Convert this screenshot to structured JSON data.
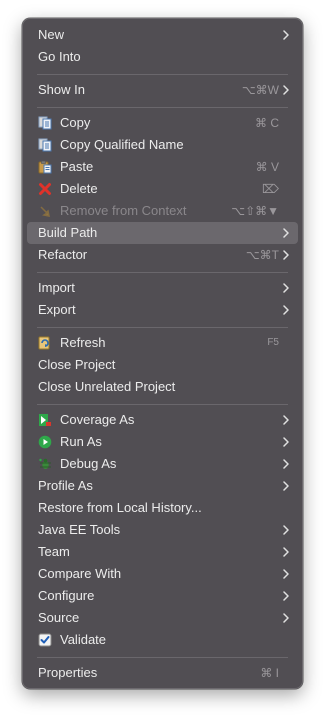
{
  "menu": {
    "items": {
      "new": {
        "label": "New"
      },
      "go_into": {
        "label": "Go Into"
      },
      "show_in": {
        "label": "Show In",
        "shortcut": "⌥⌘W"
      },
      "copy": {
        "label": "Copy",
        "shortcut": "⌘ C",
        "icon": "copy-icon"
      },
      "copy_qualified": {
        "label": "Copy Qualified Name",
        "icon": "copy-qualified-icon"
      },
      "paste": {
        "label": "Paste",
        "shortcut": "⌘ V",
        "icon": "paste-icon"
      },
      "delete": {
        "label": "Delete",
        "shortcut": "⌦",
        "icon": "delete-icon",
        "icon_color": "#e0322a"
      },
      "remove_context": {
        "label": "Remove from Context",
        "shortcut": "⌥⇧⌘▼",
        "icon": "remove-context-icon",
        "disabled": true
      },
      "build_path": {
        "label": "Build Path",
        "highlighted": true
      },
      "refactor": {
        "label": "Refactor",
        "shortcut": "⌥⌘T"
      },
      "import": {
        "label": "Import"
      },
      "export": {
        "label": "Export"
      },
      "refresh": {
        "label": "Refresh",
        "shortcut": "F5",
        "icon": "refresh-icon"
      },
      "close_project": {
        "label": "Close Project"
      },
      "close_unrelated": {
        "label": "Close Unrelated Project"
      },
      "coverage_as": {
        "label": "Coverage As",
        "icon": "coverage-icon"
      },
      "run_as": {
        "label": "Run As",
        "icon": "run-icon",
        "icon_color": "#2fa84a"
      },
      "debug_as": {
        "label": "Debug As",
        "icon": "debug-icon"
      },
      "profile_as": {
        "label": "Profile As"
      },
      "restore_history": {
        "label": "Restore from Local History..."
      },
      "java_ee_tools": {
        "label": "Java EE Tools"
      },
      "team": {
        "label": "Team"
      },
      "compare_with": {
        "label": "Compare With"
      },
      "configure": {
        "label": "Configure"
      },
      "source": {
        "label": "Source"
      },
      "validate": {
        "label": "Validate",
        "icon": "checkbox-checked-icon",
        "checked": true
      },
      "properties": {
        "label": "Properties",
        "shortcut": "⌘ I"
      }
    },
    "colors": {
      "background": "#514e53",
      "highlight": "#6b686d",
      "text": "#ececec",
      "disabled_text": "#8a878b",
      "shortcut_text": "#9a979b"
    }
  }
}
